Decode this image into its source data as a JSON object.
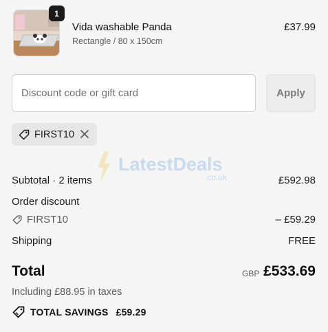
{
  "product": {
    "quantity": "1",
    "name": "Vida washable Panda",
    "variant": "Rectangle / 80 x 150cm",
    "price": "£37.99"
  },
  "discount": {
    "placeholder": "Discount code or gift card",
    "value": "",
    "apply_label": "Apply",
    "applied_code": "FIRST10"
  },
  "watermark": {
    "brand": "LatestDeals",
    "domain": ".co.uk"
  },
  "summary": {
    "subtotal_label": "Subtotal · 2 items",
    "subtotal_value": "£592.98",
    "order_discount_label": "Order discount",
    "discount_code": "FIRST10",
    "discount_value": "– £59.29",
    "shipping_label": "Shipping",
    "shipping_value": "FREE",
    "total_label": "Total",
    "currency": "GBP",
    "total_value": "£533.69",
    "taxes_note": "Including £88.95 in taxes",
    "savings_label": "TOTAL SAVINGS",
    "savings_value": "£59.29"
  },
  "colors": {
    "background": "#f5f5f5",
    "text": "#1a1a1a",
    "muted": "#5c5c5c",
    "chip": "#e6e6e6",
    "button": "#ececec"
  },
  "icons": [
    "product-thumbnail",
    "tag-icon",
    "close-icon",
    "savings-tag-icon"
  ]
}
